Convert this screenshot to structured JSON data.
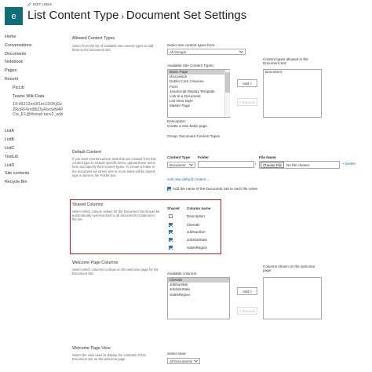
{
  "header": {
    "edit_links": "EDIT LINKS",
    "logo_letter": "e",
    "title_parent": "List Content Type",
    "title_separator": "›",
    "title_page": "Document Set Settings"
  },
  "nav": {
    "items": [
      "Home",
      "Conversations",
      "Documents",
      "Notebook",
      "Pages",
      "Recent"
    ],
    "recent": [
      "PicLib",
      "Teams Wiki Data",
      "19:d5312ec0f1ec1D0KjGvZRcRF6m9BZ5yRxcwM4PCw_E1@thread.tacv2_wiki"
    ],
    "items2": [
      "ListA",
      "ListB",
      "ListC",
      "TestLib",
      "ListD",
      "Site contents",
      "Recycle Bin"
    ]
  },
  "allowed": {
    "title": "Allowed Content Types",
    "desc": "Select from the list of available site content types to add them to the Document Set.",
    "select_label": "Select site content types from:",
    "select_value": "All Groups",
    "available_label": "Available Site Content Types:",
    "available_items": [
      "Basic Page",
      "Discussion",
      "Dublin Core Columns",
      "Form",
      "JavaScript Display Template",
      "Link to a Document",
      "List View Style",
      "Master Page"
    ],
    "add_button": "Add >",
    "remove_button": "< Remove",
    "allowed_label": "Content types allowed in the Document Set:",
    "allowed_items": [
      "Document"
    ],
    "description_label": "Description:",
    "description_text": "Create a new basic page.",
    "group_text": "Group: Document Content Types"
  },
  "default": {
    "title": "Default Content",
    "desc": "If you want new Document Sets that are created from this content type to include specific items, upload those items here and specify their content types. To create a folder in the document set where one or more items will be stored, type a name in the Folder box.",
    "col_content_type": "Content Type",
    "col_folder": "Folder",
    "col_file_name": "File Name",
    "content_type_value": "Document",
    "folder_sep": "/",
    "choose_file": "Choose File",
    "no_file": "No file chosen",
    "delete_link": "Delete",
    "add_link": "Add new default content ...",
    "checkbox_label": "Add the name of the Document Set to each file name"
  },
  "shared": {
    "title": "Shared Columns",
    "desc": "Select which column values for the Document Set should be automatically synchronized to all documents contained in the set.",
    "col_shared": "Shared",
    "col_name": "Column name",
    "rows": [
      {
        "name": "Description",
        "checked": false
      },
      {
        "name": "ClientID",
        "checked": true
      },
      {
        "name": "JobNumber",
        "checked": true
      },
      {
        "name": "JobSiteState",
        "checked": true
      },
      {
        "name": "SalesRegion",
        "checked": true
      }
    ]
  },
  "welcome": {
    "title": "Welcome Page Columns",
    "desc": "Select which columns to show on the welcome page for the Document Set.",
    "available_label": "Available columns:",
    "available_items": [
      "ClientID",
      "JobNumber",
      "JobSiteState",
      "SalesRegion"
    ],
    "add_button": "Add >",
    "remove_button": "< Remove",
    "shown_label": "Columns shown on the welcome page:"
  },
  "view": {
    "title": "Welcome Page View",
    "desc": "Select the view used to display the contents of this Document Set on the welcome page.",
    "select_label": "Select view:",
    "select_value": "All Documents"
  }
}
